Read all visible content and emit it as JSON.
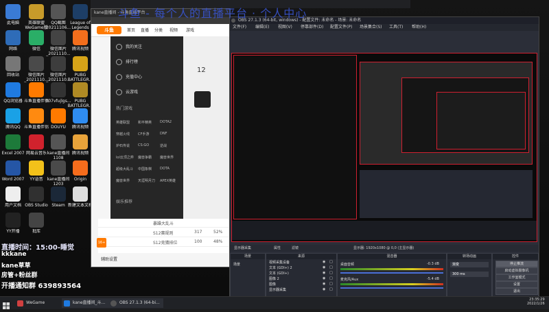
{
  "banner": {
    "text": "斗鱼 - 每个人的直播平台 · 个人中心"
  },
  "desktop_icons": [
    {
      "label": "此电脑",
      "color": "#3a7bd5"
    },
    {
      "label": "英雄联盟WeGame版",
      "color": "#c79b2a"
    },
    {
      "label": "QQ截图20211106...",
      "color": "#555"
    },
    {
      "label": "League of Legends",
      "color": "#1d3e66"
    },
    {
      "label": "网络",
      "color": "#2e6cb8"
    },
    {
      "label": "微信",
      "color": "#2aae67"
    },
    {
      "label": "微信图片_2021110...",
      "color": "#444"
    },
    {
      "label": "腾讯视频",
      "color": "#f36e1c"
    },
    {
      "label": "回收站",
      "color": "#777"
    },
    {
      "label": "微信图片_2021110...",
      "color": "#4a4a4a"
    },
    {
      "label": "微信图片_2021110...",
      "color": "#3d3d3d"
    },
    {
      "label": "PUBG BATTLEGR...",
      "color": "#d6a318"
    },
    {
      "label": "QQ浏览器",
      "color": "#1f7ae0"
    },
    {
      "label": "斗鱼直播伴侣",
      "color": "#ff7a00"
    },
    {
      "label": "007vfujlgs...",
      "color": "#333"
    },
    {
      "label": "PUBG BATTLEGR...",
      "color": "#b08a24"
    },
    {
      "label": "腾讯QQ",
      "color": "#1aa1e6"
    },
    {
      "label": "斗鱼直播伴侣",
      "color": "#ff8a10"
    },
    {
      "label": "DOUYU",
      "color": "#ff7a00"
    },
    {
      "label": "腾讯视频",
      "color": "#2f8cf0"
    },
    {
      "label": "Excel 2007",
      "color": "#1d7a3a"
    },
    {
      "label": "网易云音乐",
      "color": "#d0222d"
    },
    {
      "label": "kane直播间1108",
      "color": "#555"
    },
    {
      "label": "腾讯视频",
      "color": "#e8a33a"
    },
    {
      "label": "Word 2007",
      "color": "#2556a6"
    },
    {
      "label": "YY语音",
      "color": "#f2c11a"
    },
    {
      "label": "kane直播间1203",
      "color": "#4a4a4a"
    },
    {
      "label": "Origin",
      "color": "#f56c1c"
    },
    {
      "label": "用户文档",
      "color": "#eee"
    },
    {
      "label": "OBS Studio",
      "color": "#303030"
    },
    {
      "label": "Steam",
      "color": "#1b2838"
    },
    {
      "label": "新建文本文档",
      "color": "#ddd"
    },
    {
      "label": "YY开播",
      "color": "#222"
    },
    {
      "label": "批库",
      "color": "#444"
    }
  ],
  "browser": {
    "title": "kane直播间 - 斗鱼直播平台",
    "logo": "斗鱼",
    "nav": [
      "首页",
      "直播",
      "分类",
      "视频",
      "游戏"
    ],
    "menu": [
      "我的关注",
      "排行榜",
      "充值中心",
      "云游戏"
    ],
    "section": "热门游戏",
    "games": [
      [
        "英雄联盟",
        "和平精英",
        "DOTA2"
      ],
      [
        "穿越火线",
        "CF手游",
        "DNF"
      ],
      [
        "炉石传说",
        "CS:GO",
        "逆战"
      ],
      [
        "lol云顶之弈",
        "魔兽争霸",
        "魔兽世界"
      ],
      [
        "超级大乱斗",
        "中国象棋",
        "DOTA"
      ],
      [
        "魔兽世界",
        "天涯明月刀",
        "APEX英雄"
      ]
    ],
    "section2": "娱乐推荐",
    "fan_count": "12",
    "table": [
      [
        "暴躁大乱斗",
        "",
        ""
      ],
      [
        "S12赛规则",
        "317",
        "52%"
      ],
      [
        "S12竞猜排位",
        "100",
        "48%"
      ]
    ],
    "footer": "辅助设置"
  },
  "obs": {
    "title": "OBS 27.1.3 (64-bit, windows) - 配置文件: 未命名 - 场景: 未命名",
    "menu": [
      "文件(F)",
      "编辑(E)",
      "视图(V)",
      "停靠部件(D)",
      "配置文件(P)",
      "场景集合(S)",
      "工具(T)",
      "帮助(H)"
    ],
    "bar": "显示器采集",
    "bar_buttons": [
      "属性",
      "滤镜"
    ],
    "bar_info": "显示器: 1920x1080 @ 0,0 (主显示器)",
    "docks": [
      "场景",
      "来源",
      "混音器",
      "转场动画",
      "控件"
    ],
    "scene": "场景",
    "sources": [
      "视频采集设备",
      "文本 (GDI+) 2",
      "文本 (GDI+)",
      "图像 2",
      "图像",
      "显示器采集"
    ],
    "mixer": [
      {
        "name": "桌面音频",
        "db": "-0.3 dB"
      },
      {
        "name": "麦克风/Aux",
        "db": "-5.4 dB"
      }
    ],
    "transition": "渐变",
    "duration": "300 ms",
    "controls": [
      "停止推流",
      "启动虚拟摄像机",
      "工作室模式",
      "设置",
      "退出"
    ]
  },
  "overlay": {
    "line1": "直播时间：15:00-睡觉",
    "line2": "kkkane",
    "line3": "kane草草",
    "line4": "房管+粉丝群",
    "line5": "开播通知群 639893564"
  },
  "taskbar": {
    "items": [
      "WeGame",
      "kane直播间_斗...",
      "OBS 27.1.3 (64-bi..."
    ],
    "time": "23:35:29",
    "date": "2022/1/26"
  }
}
